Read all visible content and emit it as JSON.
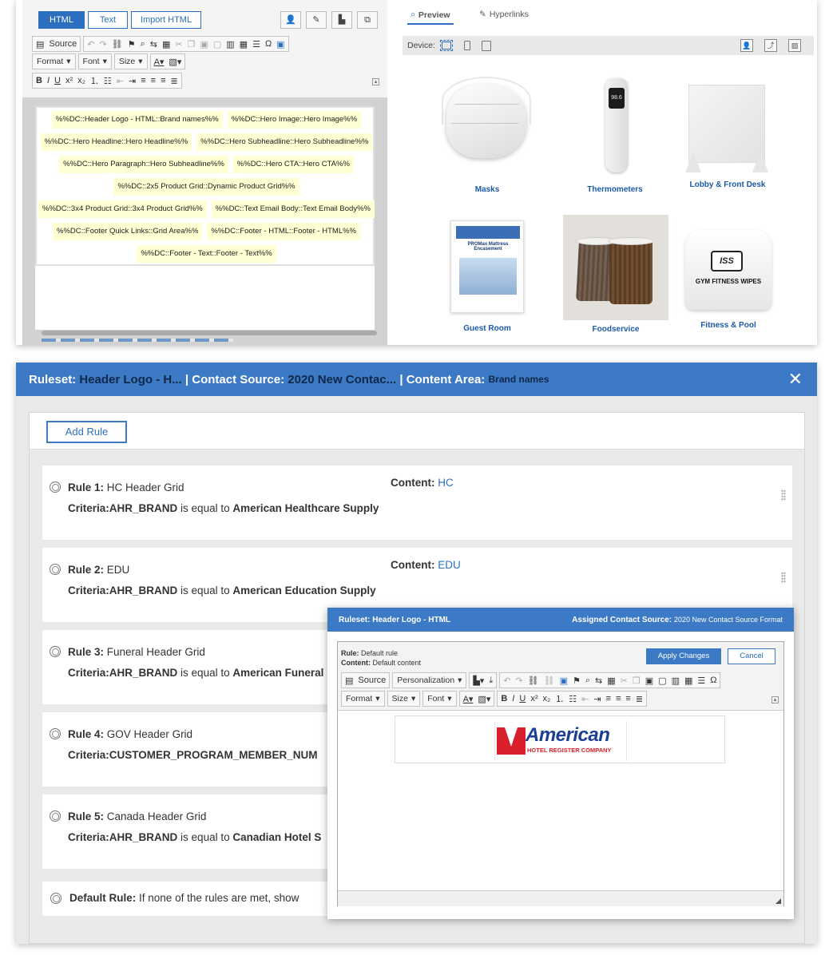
{
  "editor": {
    "tabs": [
      "HTML",
      "Text",
      "Import HTML"
    ],
    "toolbar1": {
      "source": "Source",
      "omega": "Ω"
    },
    "toolbar2": {
      "format": "Format",
      "font": "Font",
      "size": "Size"
    },
    "tokens": [
      [
        "%%DC::Header Logo - HTML::Brand names%%",
        "%%DC::Hero Image::Hero Image%%"
      ],
      [
        "%%DC::Hero Headline::Hero Headline%%",
        "%%DC::Hero Subheadline::Hero Subheadline%%"
      ],
      [
        "%%DC::Hero Paragraph::Hero Subheadline%%",
        "%%DC::Hero CTA::Hero CTA%%"
      ],
      [
        "%%DC::2x5 Product Grid::Dynamic Product Grid%%"
      ],
      [
        "%%DC::3x4 Product Grid::3x4 Product Grid%%",
        "%%DC::Text Email Body::Text Email Body%%"
      ],
      [
        "%%DC::Footer Quick Links::Grid Area%%",
        "%%DC::Footer - HTML::Footer - HTML%%"
      ],
      [
        "%%DC::Footer - Text::Footer - Text%%"
      ]
    ]
  },
  "preview": {
    "tabs": [
      "Preview",
      "Hyperlinks"
    ],
    "device_label": "Device:",
    "products": [
      {
        "label": "Masks"
      },
      {
        "label": "Thermometers"
      },
      {
        "label": "Lobby & Front Desk"
      },
      {
        "label": "Guest Room",
        "pic_title": "PROMax Mattress Encasement"
      },
      {
        "label": "Foodservice"
      },
      {
        "label": "Fitness & Pool",
        "pic_logo": "ISS",
        "pic_text": "GYM FITNESS WIPES"
      }
    ],
    "thermo_reading": "98.6"
  },
  "ruleset": {
    "ruleset_label": "Ruleset:",
    "ruleset_value": "Header Logo - H...",
    "source_label": "| Contact Source:",
    "source_value": "2020 New Contac...",
    "area_label": "| Content Area:",
    "area_value": "Brand names",
    "close": "✕",
    "add_rule": "Add Rule",
    "rules": [
      {
        "title": "Rule 1:",
        "name": "HC Header Grid",
        "criteria_label": "Criteria:",
        "field": "AHR_BRAND",
        "op": "is equal to",
        "value": "American Healthcare Supply",
        "content_label": "Content:",
        "content": "HC"
      },
      {
        "title": "Rule 2:",
        "name": "EDU",
        "criteria_label": "Criteria:",
        "field": "AHR_BRAND",
        "op": "is equal to",
        "value": "American Education Supply",
        "content_label": "Content:",
        "content": "EDU"
      },
      {
        "title": "Rule 3:",
        "name": "Funeral Header Grid",
        "criteria_label": "Criteria:",
        "field": "AHR_BRAND",
        "op": "is equal to",
        "value": "American Funeral"
      },
      {
        "title": "Rule 4:",
        "name": "GOV Header Grid",
        "criteria_label": "Criteria:",
        "field": "CUSTOMER_PROGRAM_MEMBER_NUM",
        "op": "",
        "value": ""
      },
      {
        "title": "Rule 5:",
        "name": "Canada Header Grid",
        "criteria_label": "Criteria:",
        "field": "AHR_BRAND",
        "op": "is equal to",
        "value": "Canadian Hotel S"
      }
    ],
    "default_rule": {
      "title": "Default Rule:",
      "text": "If none of the rules are met, show"
    }
  },
  "dialog": {
    "title": "Ruleset: Header Logo - HTML",
    "source_label": "Assigned Contact Source:",
    "source_value": "2020 New Contact Source Format",
    "rule_label": "Rule:",
    "rule_value": "Default rule",
    "content_label": "Content:",
    "content_value": "Default content",
    "apply": "Apply Changes",
    "cancel": "Cancel",
    "toolbar": {
      "source": "Source",
      "personalization": "Personalization",
      "format": "Format",
      "size": "Size",
      "font": "Font"
    },
    "logo_word": "American",
    "logo_sub": "HOTEL REGISTER COMPANY"
  },
  "colors": {
    "accent": "#3d7ac5",
    "link": "#2c6fbf",
    "token_bg": "#ffffd4",
    "brand_red": "#d81f2a",
    "brand_navy": "#1c3f94"
  }
}
